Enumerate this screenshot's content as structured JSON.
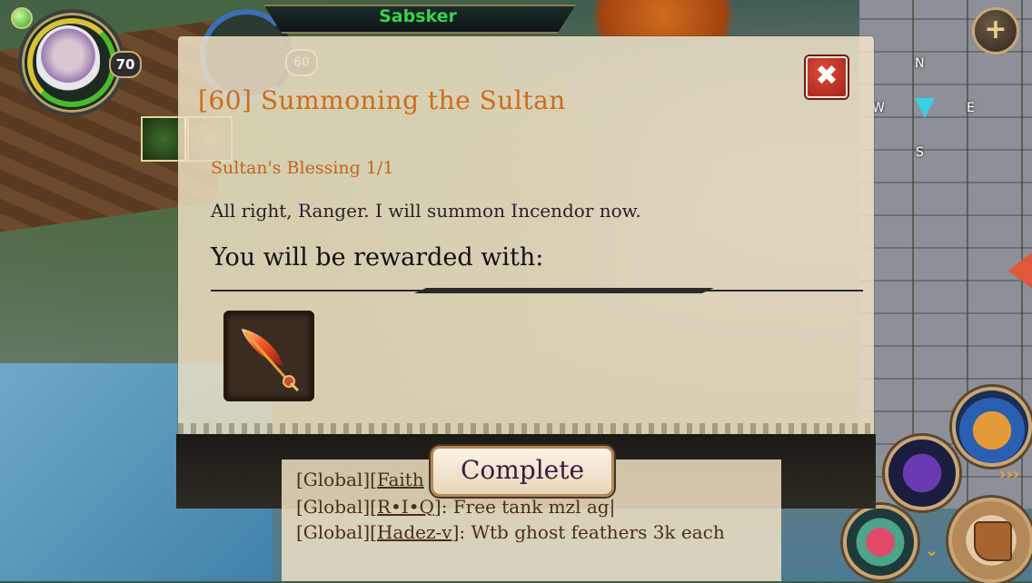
{
  "hud": {
    "player_level": "70",
    "target_level": "60",
    "target_name": "Sabsker",
    "plus_label": "+",
    "compass": {
      "n": "N",
      "e": "E",
      "s": "S",
      "w": "W"
    }
  },
  "quest": {
    "title": "[60] Summoning the Sultan",
    "close_label": "✖",
    "objective": "Sultan's Blessing  1/1",
    "dialogue": "All right, Ranger. I will summon Incendor now.",
    "reward_heading": "You will be rewarded with:",
    "reward_item_icon": "flame-feather-icon",
    "complete_label": "Complete"
  },
  "chat": {
    "lines": [
      {
        "prefix": "[Global][",
        "user": "Faith",
        "text": ""
      },
      {
        "prefix": "[Global][",
        "user": "R•I•Q",
        "text": "]: Free tank mzl ag|"
      },
      {
        "prefix": "[Global][",
        "user": "Hadez-v",
        "text": "]: Wtb ghost feathers 3k each"
      }
    ]
  },
  "colors": {
    "title": "#d06b1c",
    "objective": "#c0661c",
    "target_name": "#38d34c",
    "close_button": "#c5281c"
  }
}
